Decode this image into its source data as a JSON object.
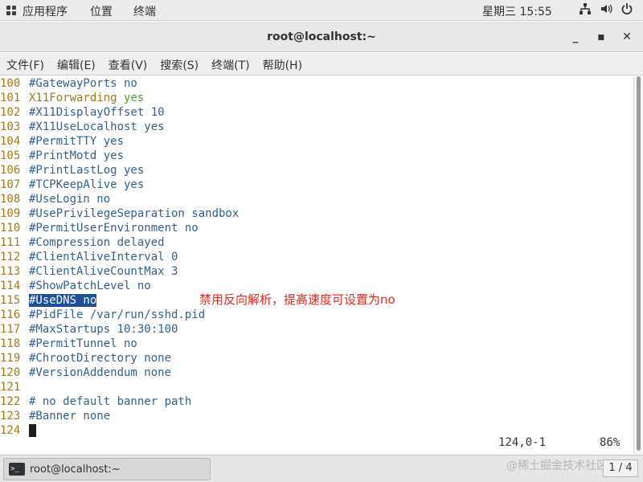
{
  "topbar": {
    "apps_label": "应用程序",
    "places_label": "位置",
    "terminal_label": "终端",
    "clock": "星期三 15:55",
    "icons": [
      "network-icon",
      "volume-icon",
      "power-icon"
    ]
  },
  "window": {
    "title": "root@localhost:~",
    "minimize": "_",
    "maximize": "▪",
    "close": "✕"
  },
  "menubar": {
    "items": [
      "文件(F)",
      "编辑(E)",
      "查看(V)",
      "搜索(S)",
      "终端(T)",
      "帮助(H)"
    ]
  },
  "editor": {
    "lines": [
      {
        "n": "100",
        "text": "#GatewayPorts no"
      },
      {
        "n": "101",
        "opt": "X11Forwarding",
        "val": "yes"
      },
      {
        "n": "102",
        "text": "#X11DisplayOffset 10"
      },
      {
        "n": "103",
        "text": "#X11UseLocalhost yes"
      },
      {
        "n": "104",
        "text": "#PermitTTY yes"
      },
      {
        "n": "105",
        "text": "#PrintMotd yes"
      },
      {
        "n": "106",
        "text": "#PrintLastLog yes"
      },
      {
        "n": "107",
        "text": "#TCPKeepAlive yes"
      },
      {
        "n": "108",
        "text": "#UseLogin no"
      },
      {
        "n": "109",
        "text": "#UsePrivilegeSeparation sandbox"
      },
      {
        "n": "110",
        "text": "#PermitUserEnvironment no"
      },
      {
        "n": "111",
        "text": "#Compression delayed"
      },
      {
        "n": "112",
        "text": "#ClientAliveInterval 0"
      },
      {
        "n": "113",
        "text": "#ClientAliveCountMax 3"
      },
      {
        "n": "114",
        "text": "#ShowPatchLevel no"
      },
      {
        "n": "115",
        "selected": "#UseDNS no"
      },
      {
        "n": "116",
        "text": "#PidFile /var/run/sshd.pid"
      },
      {
        "n": "117",
        "text": "#MaxStartups 10:30:100"
      },
      {
        "n": "118",
        "text": "#PermitTunnel no"
      },
      {
        "n": "119",
        "text": "#ChrootDirectory none"
      },
      {
        "n": "120",
        "text": "#VersionAddendum none"
      },
      {
        "n": "121",
        "text": ""
      },
      {
        "n": "122",
        "text": "# no default banner path"
      },
      {
        "n": "123",
        "text": "#Banner none"
      },
      {
        "n": "124",
        "cursor": true
      }
    ],
    "annotation": "禁用反向解析，提高速度可设置为no",
    "status_position": "124,0-1",
    "status_percent": "86%"
  },
  "taskbar": {
    "task_label": "root@localhost:~",
    "watermark": "@稀土掘金技术社区",
    "pager": "1 / 4"
  }
}
